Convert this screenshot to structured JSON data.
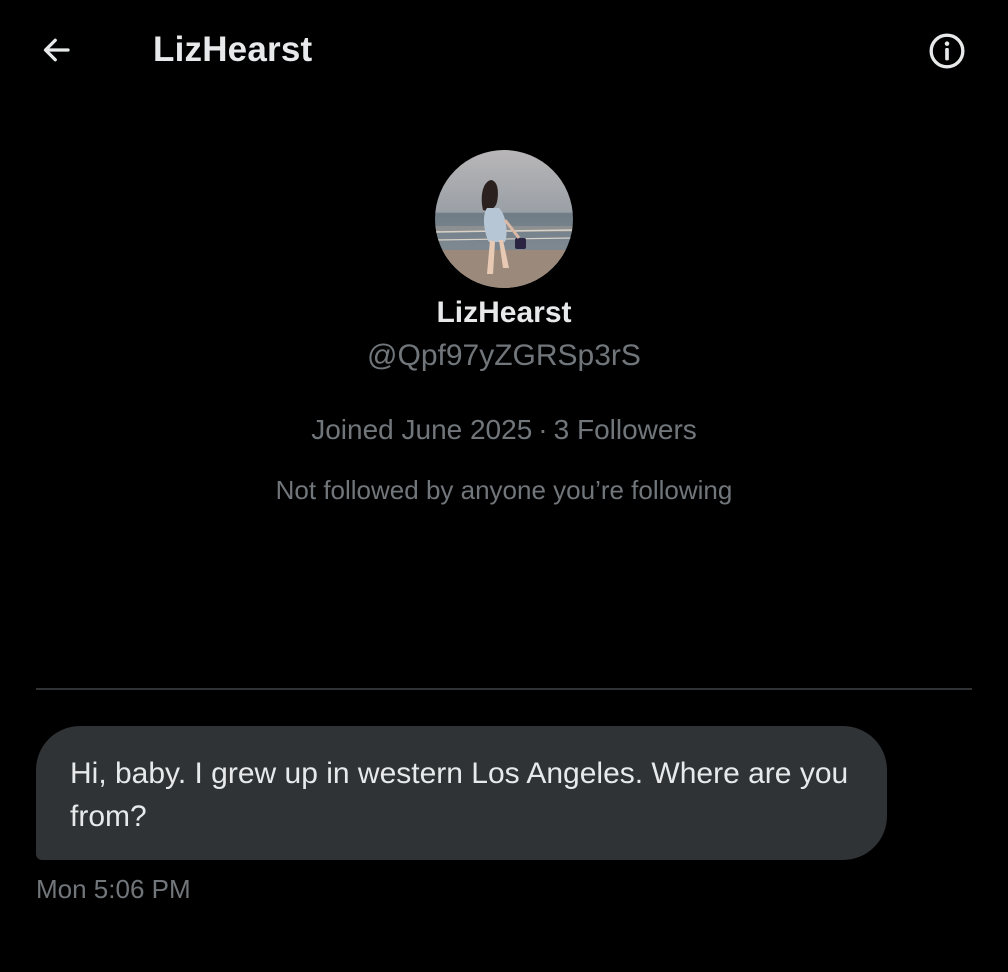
{
  "header": {
    "title": "LizHearst",
    "back_icon": "arrow-left-icon",
    "info_icon": "info-circle-icon"
  },
  "profile": {
    "display_name": "LizHearst",
    "handle": "@Qpf97yZGRSp3rS",
    "joined": "Joined June 2025",
    "separator": "·",
    "followers": "3 Followers",
    "followed_by": "Not followed by anyone you’re following"
  },
  "messages": [
    {
      "text": "Hi, baby. I grew up in western Los Angeles. Where are you from?",
      "timestamp": "Mon 5:06 PM"
    }
  ],
  "colors": {
    "background": "#000000",
    "primary_text": "#e7e9ea",
    "secondary_text": "#71767b",
    "bubble": "#2f3336",
    "divider": "#2f3336"
  }
}
